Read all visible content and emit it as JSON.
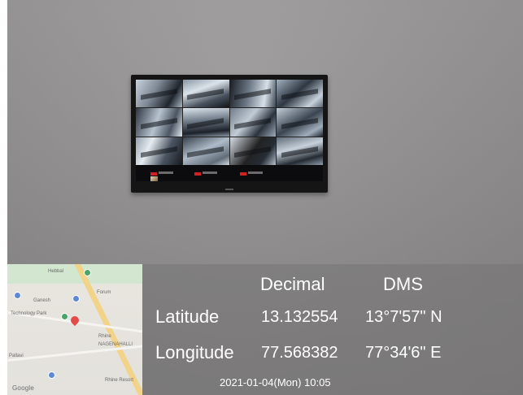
{
  "map": {
    "brand": "Google",
    "labels": [
      "Hebbal",
      "Technology Park",
      "Ganesh",
      "Forum",
      "Rhine",
      "NAGENAHALLI",
      "Pallavi",
      "Rhine Resort"
    ]
  },
  "gps": {
    "col_decimal": "Decimal",
    "col_dms": "DMS",
    "latitude_label": "Latitude",
    "longitude_label": "Longitude",
    "latitude_decimal": "13.132554",
    "latitude_dms": "13°7'57\" N",
    "longitude_decimal": "77.568382",
    "longitude_dms": "77°34'6\" E",
    "datetime": "2021-01-04(Mon)  10:05"
  }
}
